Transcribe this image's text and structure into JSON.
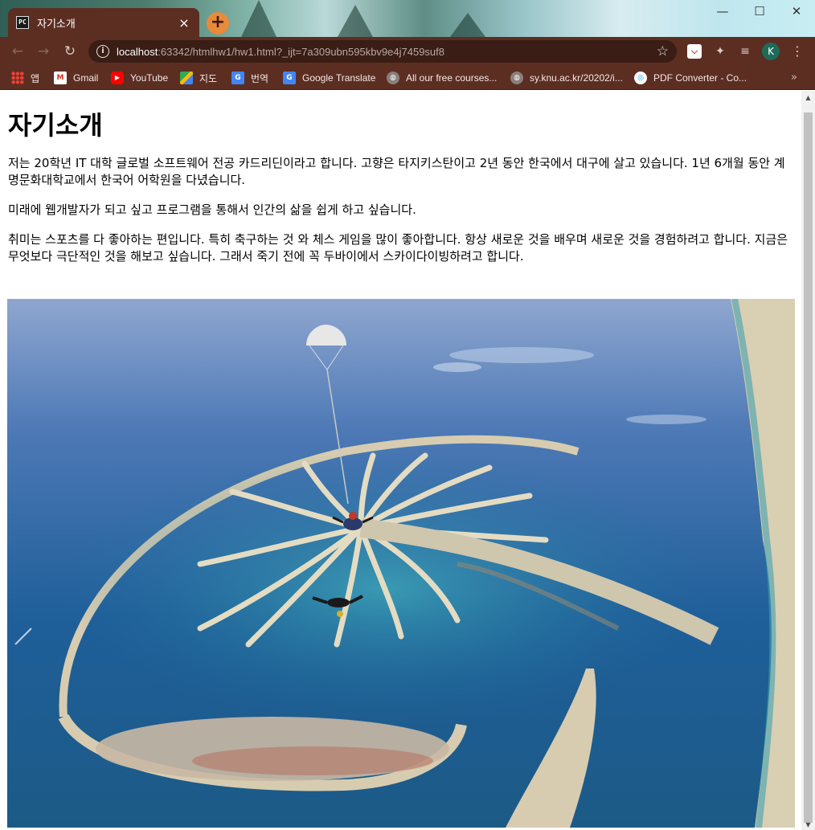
{
  "window": {
    "tab_title": "자기소개",
    "tab_favicon": "PC",
    "close_tab": "×",
    "new_tab": "+",
    "minimize": "—",
    "maximize": "☐",
    "close": "✕"
  },
  "toolbar": {
    "back": "←",
    "forward": "→",
    "reload": "↻",
    "url_host": "localhost",
    "url_path": ":63342/htmlhw1/hw1.html?_ijt=7a309ubn595kbv9e4j7459suf8",
    "star": "☆",
    "profile_initial": "K",
    "menu": "⋮"
  },
  "bookmarks": [
    {
      "label": "앱",
      "icon": "apps-grid-icon"
    },
    {
      "label": "Gmail",
      "icon": "gmail-icon"
    },
    {
      "label": "YouTube",
      "icon": "youtube-icon"
    },
    {
      "label": "지도",
      "icon": "maps-icon"
    },
    {
      "label": "번역",
      "icon": "translate-icon"
    },
    {
      "label": "Google Translate",
      "icon": "translate-icon"
    },
    {
      "label": "All our free courses...",
      "icon": "globe-icon"
    },
    {
      "label": "sy.knu.ac.kr/20202/i...",
      "icon": "globe-icon"
    },
    {
      "label": "PDF Converter - Co...",
      "icon": "pdf-converter-icon"
    }
  ],
  "bookmarks_more": "»",
  "page": {
    "heading": "자기소개",
    "paragraph_1": "저는 20학년 IT 대학 글로벌 소프트웨어 전공 카드리딘이라고 합니다. 고향은 타지키스탄이고 2년 동안 한국에서 대구에 살고 있습니다. 1년 6개월 동안 계명문화대학교에서 한국어 어학원을 다녔습니다.",
    "paragraph_2": "미래에 웹개발자가 되고 싶고 프로그램을 통해서 인간의 삶을 쉽게 하고 싶습니다.",
    "paragraph_3": "취미는 스포츠를 다 좋아하는 편입니다. 특히 축구하는 것 와 체스 게임을 많이 좋아합니다. 항상 새로운 것을 배우며 새로운 것을 경험하려고 합니다. 지금은 무엇보다 극단적인 것을 해보고 싶습니다. 그래서 죽기 전에 꼭 두바이에서 스카이다이빙하려고 합니다."
  },
  "colors": {
    "browser_frame": "#5c2e22",
    "omnibox": "#3a1d15",
    "new_tab_button": "#e98a3a",
    "sea": "#1f5f9a",
    "island_sand": "#d8cfb8"
  }
}
